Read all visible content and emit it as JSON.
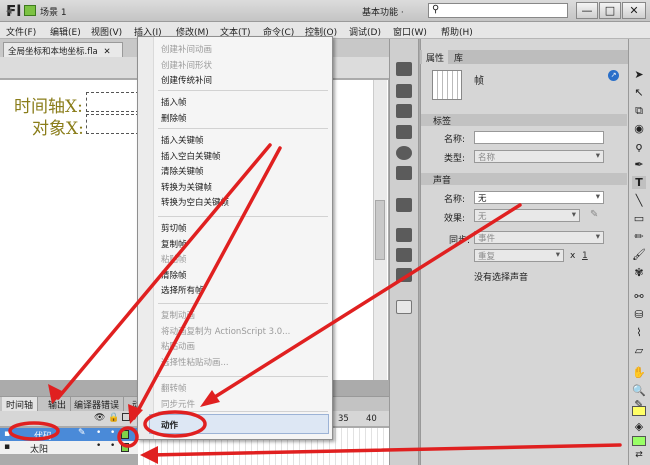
{
  "app": {
    "logo": "Fl",
    "workspace": "基本功能 ·",
    "search_icon": "⚲"
  },
  "window_buttons": [
    "—",
    "□",
    "✕"
  ],
  "menubar": [
    {
      "label": "文件(F)"
    },
    {
      "label": "编辑(E)"
    },
    {
      "label": "视图(V)"
    },
    {
      "label": "插入(I)"
    },
    {
      "label": "修改(M)"
    },
    {
      "label": "文本(T)"
    },
    {
      "label": "命令(C)"
    },
    {
      "label": "控制(O)"
    },
    {
      "label": "调试(D)"
    },
    {
      "label": "窗口(W)"
    },
    {
      "label": "帮助(H)"
    }
  ],
  "document": {
    "tab": "全局坐标和本地坐标.fla",
    "close_icon": "✕",
    "scene": "场景 1",
    "back_icon": "◂"
  },
  "stage": {
    "line1": "时间轴X:",
    "line2": "对象X:"
  },
  "timeline": {
    "tabs": [
      "时间轴",
      "输出",
      "编译器错误",
      "动"
    ],
    "frame_numbers": [
      "35",
      "40"
    ],
    "layers": [
      {
        "name": "代码"
      },
      {
        "name": "太阳"
      }
    ]
  },
  "context_menu": {
    "group1": [
      {
        "label": "创建补间动画",
        "enabled": false
      },
      {
        "label": "创建补间形状",
        "enabled": false
      },
      {
        "label": "创建传统补间",
        "enabled": true
      }
    ],
    "group2": [
      {
        "label": "插入帧",
        "enabled": true
      },
      {
        "label": "删除帧",
        "enabled": true
      }
    ],
    "group3": [
      {
        "label": "插入关键帧",
        "enabled": true
      },
      {
        "label": "插入空白关键帧",
        "enabled": true
      },
      {
        "label": "清除关键帧",
        "enabled": true
      },
      {
        "label": "转换为关键帧",
        "enabled": true
      },
      {
        "label": "转换为空白关键帧",
        "enabled": true
      }
    ],
    "group4": [
      {
        "label": "剪切帧",
        "enabled": true
      },
      {
        "label": "复制帧",
        "enabled": true
      },
      {
        "label": "粘贴帧",
        "enabled": false
      },
      {
        "label": "清除帧",
        "enabled": true
      },
      {
        "label": "选择所有帧",
        "enabled": true
      }
    ],
    "group5": [
      {
        "label": "复制动画",
        "enabled": false
      },
      {
        "label": "将动画复制为 ActionScript 3.0...",
        "enabled": false
      },
      {
        "label": "粘贴动画",
        "enabled": false
      },
      {
        "label": "选择性粘贴动画...",
        "enabled": false
      }
    ],
    "group6": [
      {
        "label": "翻转帧",
        "enabled": false
      },
      {
        "label": "同步元件",
        "enabled": false
      }
    ],
    "actions": {
      "label": "动作",
      "enabled": true
    }
  },
  "properties": {
    "tabs": [
      "属性",
      "库"
    ],
    "title": "帧",
    "label_section": "标签",
    "name_label": "名称:",
    "name_value": "",
    "type_label": "类型:",
    "type_value": "名称",
    "sound_section": "声音",
    "sound_name_label": "名称:",
    "sound_name_value": "无",
    "effect_label": "效果:",
    "effect_value": "无",
    "sync_label": "同步:",
    "sync_value": "事件",
    "repeat_value": "重复",
    "repeat_x": "x",
    "repeat_count": "1",
    "no_sound": "没有选择声音"
  },
  "accent_colors": {
    "keyframe": "#7fd34a",
    "layer_selected": "#4a8ad8",
    "annotation": "#e02020"
  }
}
